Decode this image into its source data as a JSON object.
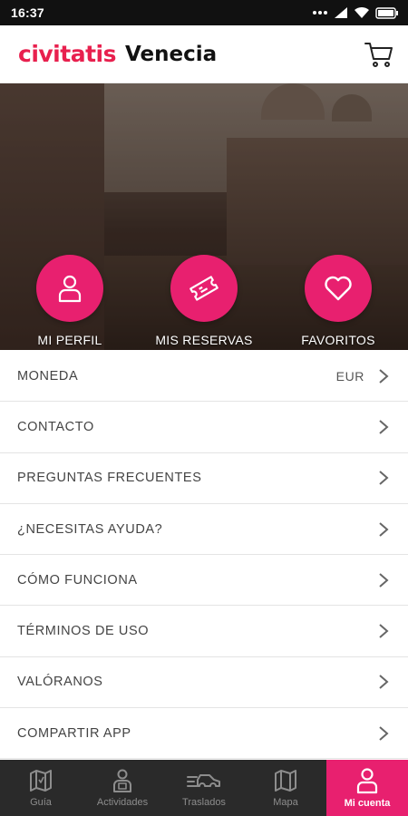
{
  "status_bar": {
    "time": "16:37"
  },
  "header": {
    "brand": "civitatis",
    "city": "Venecia"
  },
  "hero": {
    "actions": [
      {
        "label": "MI PERFIL",
        "icon": "user-icon"
      },
      {
        "label": "MIS RESERVAS",
        "icon": "ticket-icon"
      },
      {
        "label": "FAVORITOS",
        "icon": "heart-icon"
      }
    ]
  },
  "menu": {
    "items": [
      {
        "label": "MONEDA",
        "value": "EUR"
      },
      {
        "label": "CONTACTO"
      },
      {
        "label": "PREGUNTAS FRECUENTES"
      },
      {
        "label": "¿NECESITAS AYUDA?"
      },
      {
        "label": "CÓMO FUNCIONA"
      },
      {
        "label": "TÉRMINOS DE USO"
      },
      {
        "label": "VALÓRANOS"
      },
      {
        "label": "COMPARTIR APP"
      }
    ]
  },
  "bottom_nav": {
    "tabs": [
      {
        "label": "Guía",
        "icon": "map-guide-icon",
        "active": false
      },
      {
        "label": "Actividades",
        "icon": "guide-person-icon",
        "active": false
      },
      {
        "label": "Traslados",
        "icon": "car-icon",
        "active": false
      },
      {
        "label": "Mapa",
        "icon": "map-icon",
        "active": false
      },
      {
        "label": "Mi cuenta",
        "icon": "user-icon",
        "active": true
      }
    ]
  },
  "colors": {
    "brand": "#e8204e",
    "accent": "#e8206f",
    "nav_bg": "#2a2a2a"
  }
}
